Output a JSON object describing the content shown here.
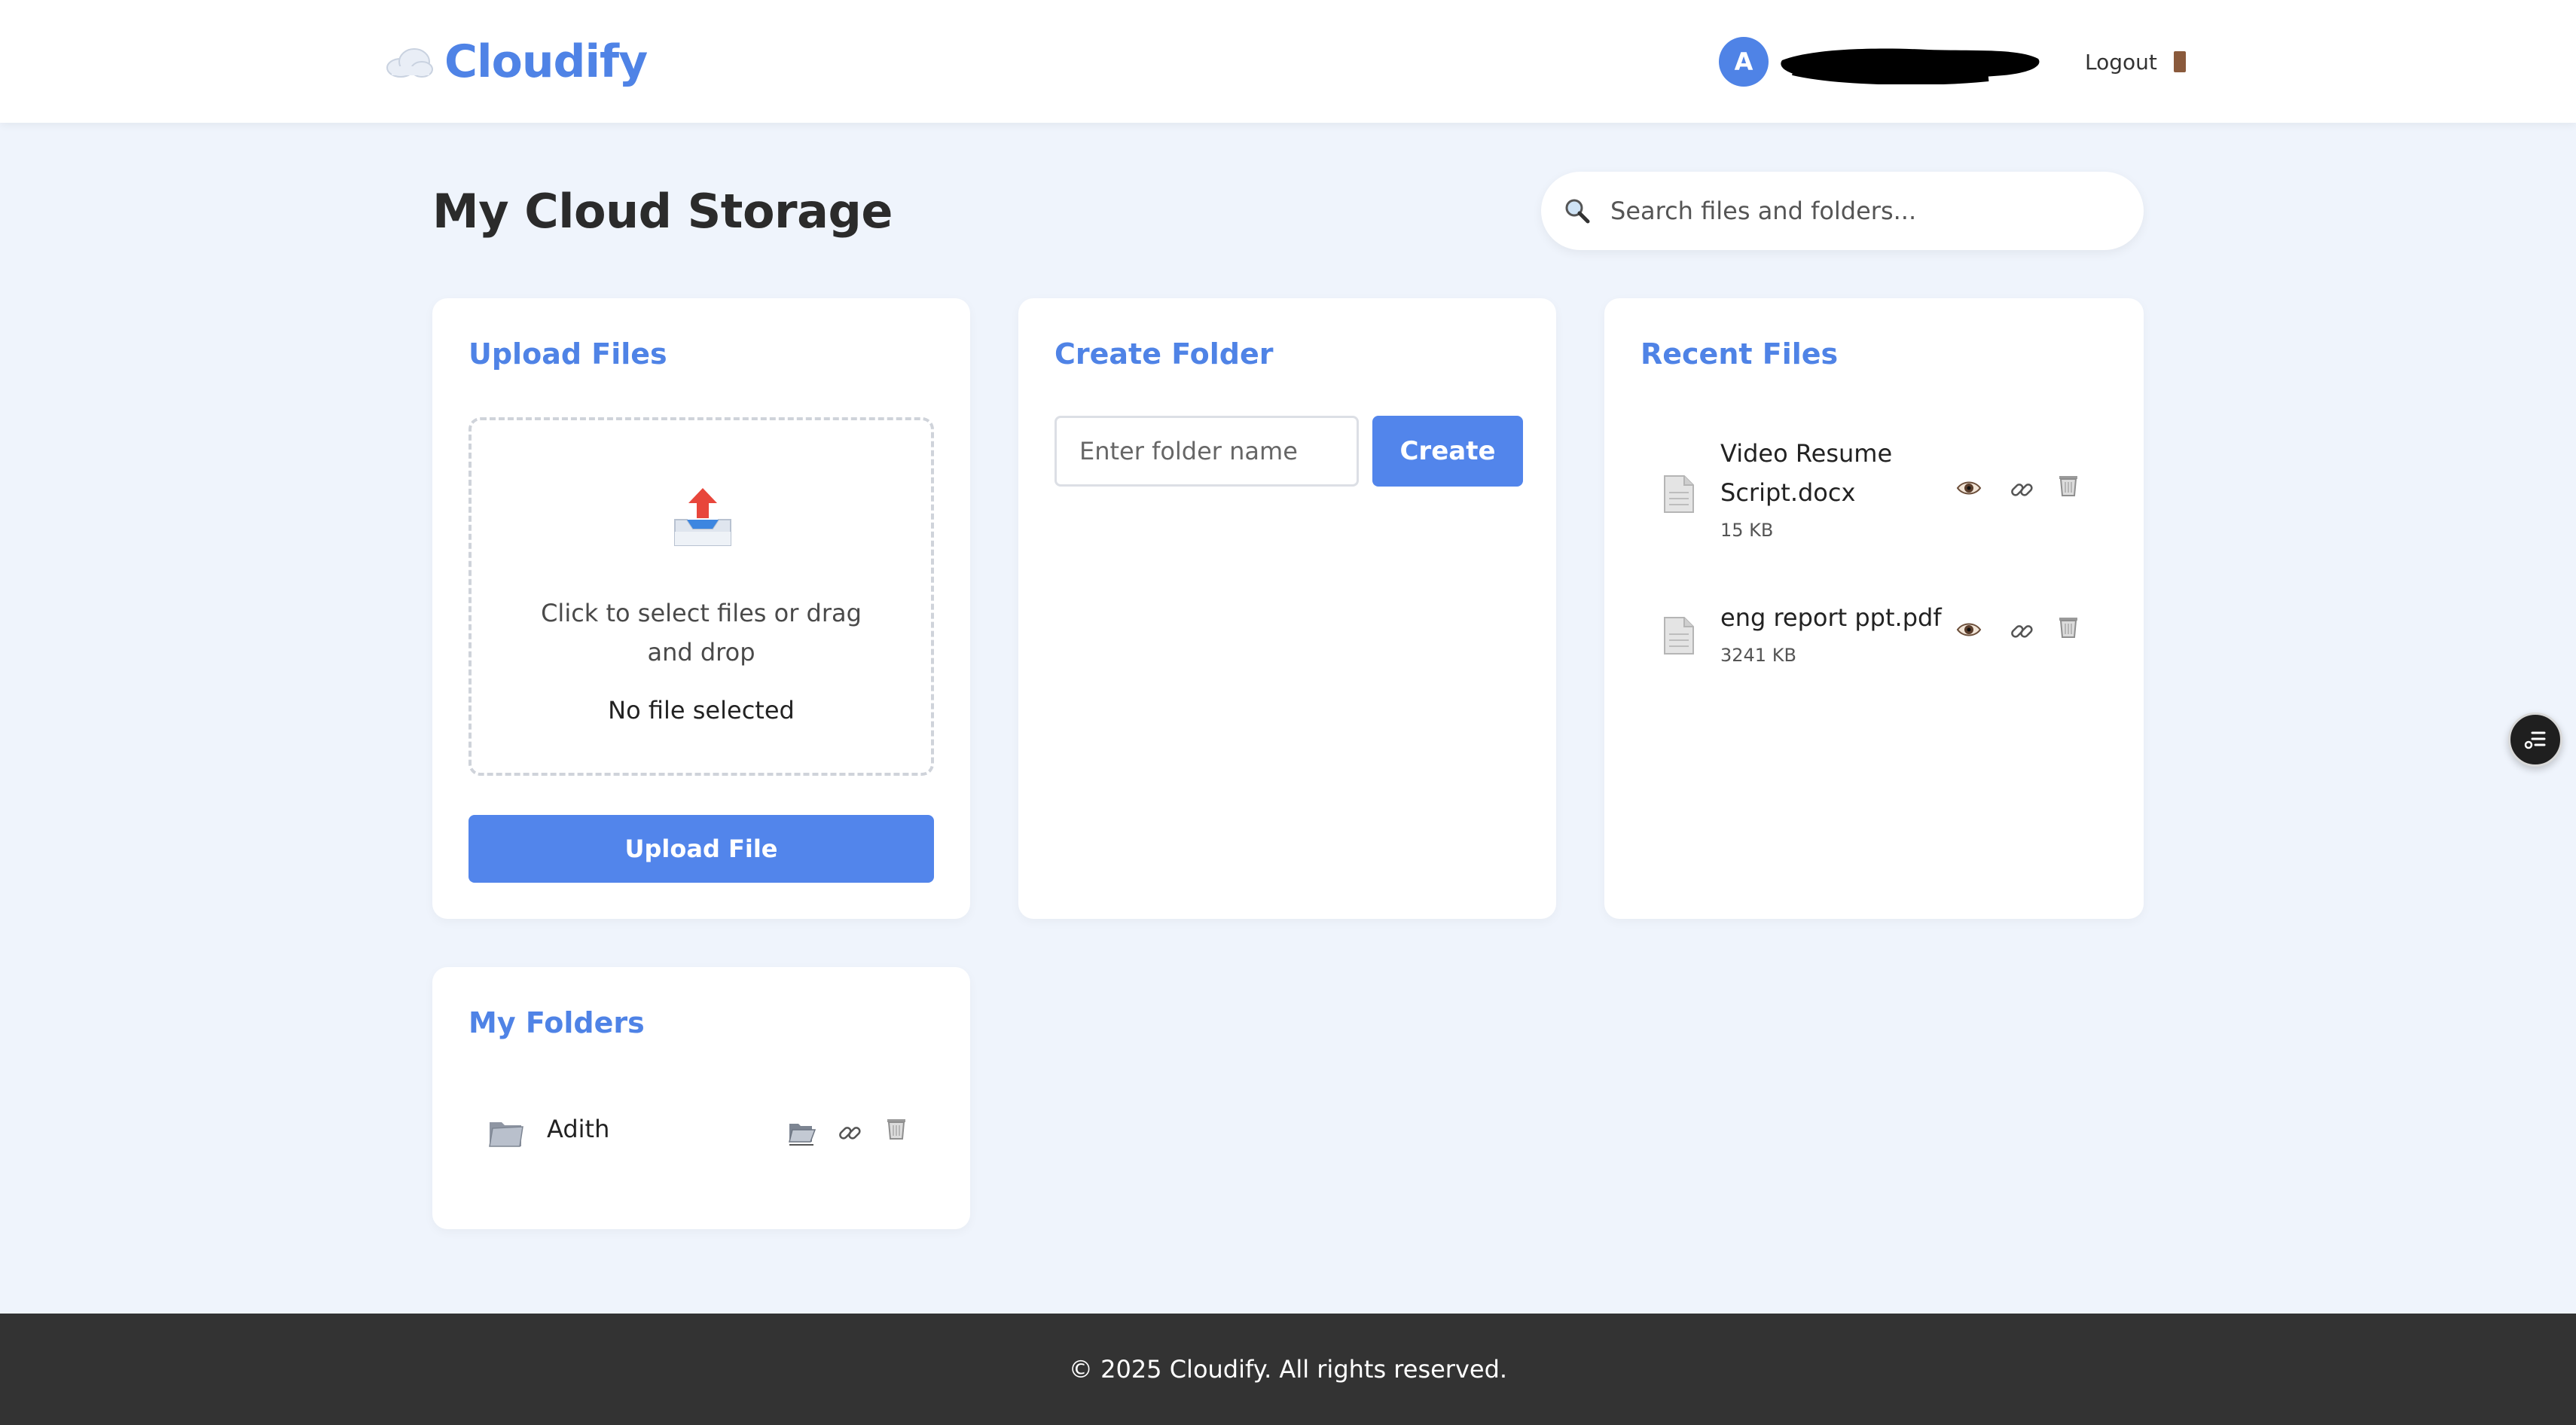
{
  "header": {
    "brand": "Cloudify",
    "avatar_initial": "A",
    "logout_label": "Logout"
  },
  "page": {
    "title": "My Cloud Storage",
    "search_placeholder": "Search files and folders..."
  },
  "upload": {
    "title": "Upload Files",
    "dropzone_text": "Click to select files or drag and drop",
    "status": "No file selected",
    "button_label": "Upload File"
  },
  "create_folder": {
    "title": "Create Folder",
    "input_placeholder": "Enter folder name",
    "button_label": "Create"
  },
  "recent_files": {
    "title": "Recent Files",
    "items": [
      {
        "name": "Video Resume Script.docx",
        "size": "15 KB"
      },
      {
        "name": "eng report ppt.pdf",
        "size": "3241 KB"
      }
    ]
  },
  "my_folders": {
    "title": "My Folders",
    "items": [
      {
        "name": "Adith"
      }
    ]
  },
  "footer": {
    "text": "© 2025 Cloudify. All rights reserved."
  },
  "colors": {
    "accent": "#4f83e6",
    "button": "#5285eb",
    "background": "#eff4fc",
    "footer": "#333333"
  }
}
